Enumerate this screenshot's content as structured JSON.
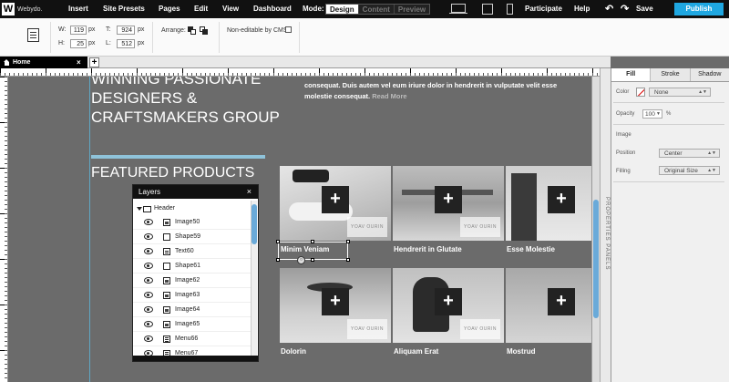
{
  "app": {
    "logo_letter": "W",
    "logo_text": "Webydo.",
    "menu": [
      "Insert",
      "Site Presets",
      "Pages",
      "Edit",
      "View",
      "Dashboard"
    ],
    "mode_label": "Mode:",
    "modes": [
      "Design",
      "Content",
      "Preview"
    ],
    "active_mode": "Design",
    "right_menu": {
      "participate": "Participate",
      "help": "Help",
      "undo_icon": "undo-icon",
      "redo_icon": "redo-icon",
      "save": "Save",
      "publish": "Publish"
    },
    "publish_color": "#1fa7e1"
  },
  "toolbar": {
    "w_label": "W:",
    "w_value": "119",
    "w_unit": "px",
    "h_label": "H:",
    "h_value": "25",
    "h_unit": "px",
    "t_label": "T:",
    "t_value": "924",
    "t_unit": "px",
    "l_label": "L:",
    "l_value": "512",
    "l_unit": "px",
    "arrange_label": "Arrange:",
    "cms_label": "Non-editable by CMS"
  },
  "tabs": {
    "home": "Home",
    "close": "×",
    "add": "+"
  },
  "canvas": {
    "heading_line1": "WINNING PASSIONATE",
    "heading_line2": "DESIGNERS &",
    "heading_line3": "CRAFTSMAKERS GROUP",
    "intro_line1": "consequat. Duis autem vel eum iriure dolor in hendrerit in vulputate velit esse",
    "intro_line2": "molestie consequat.",
    "intro_more": "Read More",
    "featured_title": "FEATURED PRODUCTS",
    "accent_bar_color": "#8fc3da",
    "products": [
      {
        "name": "Minim Veniam",
        "plus": "+",
        "brand": "YOAV OURIN"
      },
      {
        "name": "Hendrerit in Glutate",
        "plus": "+",
        "brand": "YOAV OURIN"
      },
      {
        "name": "Esse Molestie",
        "plus": "+",
        "brand": ""
      },
      {
        "name": "Dolorin",
        "plus": "+",
        "brand": "YOAV OURIN"
      },
      {
        "name": "Aliquam Erat",
        "plus": "+",
        "brand": "YOAV OURIN"
      },
      {
        "name": "Mostrud",
        "plus": "+",
        "brand": ""
      }
    ]
  },
  "layers": {
    "title": "Layers",
    "close": "×",
    "group": "Header",
    "items": [
      {
        "name": "Image50",
        "type": "img"
      },
      {
        "name": "Shape59",
        "type": "shape"
      },
      {
        "name": "Text60",
        "type": "txt"
      },
      {
        "name": "Shape61",
        "type": "shape"
      },
      {
        "name": "Image62",
        "type": "img"
      },
      {
        "name": "Image63",
        "type": "img"
      },
      {
        "name": "Image64",
        "type": "img"
      },
      {
        "name": "Image65",
        "type": "img"
      },
      {
        "name": "Menu66",
        "type": "menu"
      },
      {
        "name": "Menu67",
        "type": "menu"
      }
    ]
  },
  "props_side_label": "PROPERTIES PANELS",
  "properties": {
    "tabs": [
      "Fill",
      "Stroke",
      "Shadow"
    ],
    "active_tab": "Fill",
    "color_label": "Color",
    "color_value": "None",
    "opacity_label": "Opacity",
    "opacity_value": "100",
    "opacity_unit": "%",
    "image_label": "Image",
    "position_label": "Position",
    "position_value": "Center",
    "filling_label": "Filling",
    "filling_value": "Original Size"
  }
}
